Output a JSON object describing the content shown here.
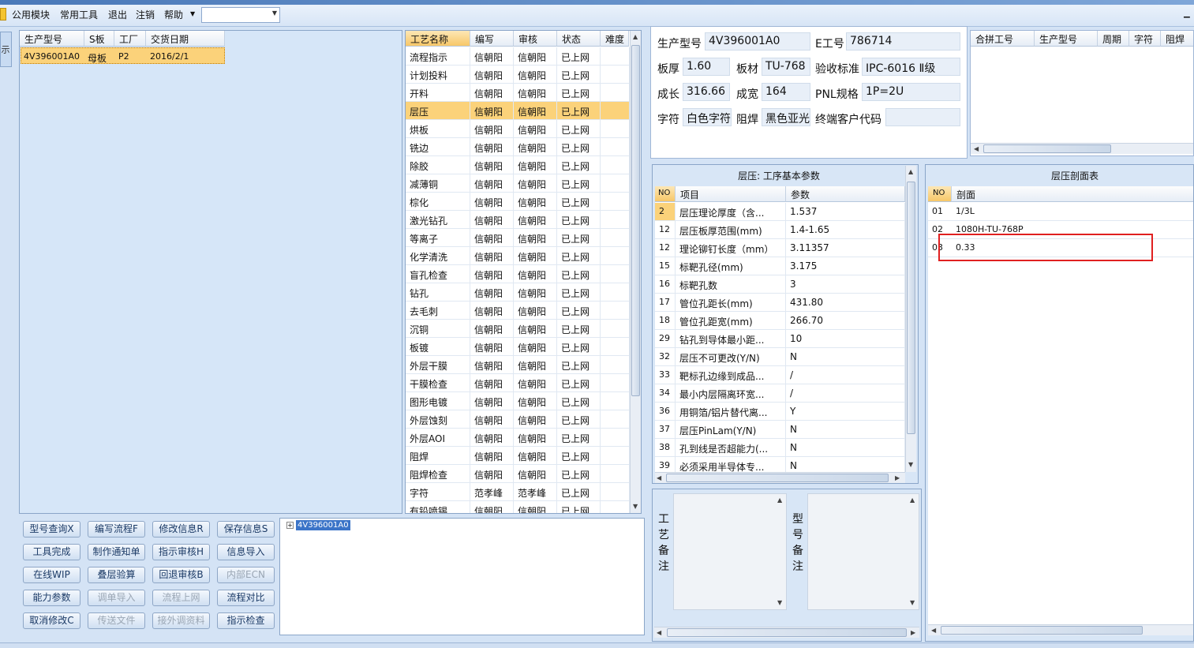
{
  "menu": {
    "items": [
      "公用模块",
      "常用工具",
      "退出",
      "注销",
      "帮助"
    ],
    "combo_value": ""
  },
  "left_tab": "示",
  "orders": {
    "headers": [
      "生产型号",
      "S板",
      "工厂",
      "交货日期"
    ],
    "rows": [
      [
        "4V396001A0",
        "母板",
        "P2",
        "2016/2/1"
      ]
    ]
  },
  "process": {
    "headers": [
      "工艺名称",
      "编写",
      "审核",
      "状态",
      "难度"
    ],
    "rows": [
      [
        "流程指示",
        "信朝阳",
        "信朝阳",
        "已上网",
        ""
      ],
      [
        "计划投料",
        "信朝阳",
        "信朝阳",
        "已上网",
        ""
      ],
      [
        "开料",
        "信朝阳",
        "信朝阳",
        "已上网",
        ""
      ],
      [
        "层压",
        "信朝阳",
        "信朝阳",
        "已上网",
        ""
      ],
      [
        "烘板",
        "信朝阳",
        "信朝阳",
        "已上网",
        ""
      ],
      [
        "铣边",
        "信朝阳",
        "信朝阳",
        "已上网",
        ""
      ],
      [
        "除胶",
        "信朝阳",
        "信朝阳",
        "已上网",
        ""
      ],
      [
        "减薄铜",
        "信朝阳",
        "信朝阳",
        "已上网",
        ""
      ],
      [
        "棕化",
        "信朝阳",
        "信朝阳",
        "已上网",
        ""
      ],
      [
        "激光钻孔",
        "信朝阳",
        "信朝阳",
        "已上网",
        ""
      ],
      [
        "等离子",
        "信朝阳",
        "信朝阳",
        "已上网",
        ""
      ],
      [
        "化学清洗",
        "信朝阳",
        "信朝阳",
        "已上网",
        ""
      ],
      [
        "盲孔检查",
        "信朝阳",
        "信朝阳",
        "已上网",
        ""
      ],
      [
        "钻孔",
        "信朝阳",
        "信朝阳",
        "已上网",
        ""
      ],
      [
        "去毛刺",
        "信朝阳",
        "信朝阳",
        "已上网",
        ""
      ],
      [
        "沉铜",
        "信朝阳",
        "信朝阳",
        "已上网",
        ""
      ],
      [
        "板镀",
        "信朝阳",
        "信朝阳",
        "已上网",
        ""
      ],
      [
        "外层干膜",
        "信朝阳",
        "信朝阳",
        "已上网",
        ""
      ],
      [
        "干膜检查",
        "信朝阳",
        "信朝阳",
        "已上网",
        ""
      ],
      [
        "图形电镀",
        "信朝阳",
        "信朝阳",
        "已上网",
        ""
      ],
      [
        "外层蚀刻",
        "信朝阳",
        "信朝阳",
        "已上网",
        ""
      ],
      [
        "外层AOI",
        "信朝阳",
        "信朝阳",
        "已上网",
        ""
      ],
      [
        "阻焊",
        "信朝阳",
        "信朝阳",
        "已上网",
        ""
      ],
      [
        "阻焊检查",
        "信朝阳",
        "信朝阳",
        "已上网",
        ""
      ],
      [
        "字符",
        "范孝峰",
        "范孝峰",
        "已上网",
        ""
      ],
      [
        "有铅喷锡",
        "信朝阳",
        "信朝阳",
        "已上网",
        ""
      ]
    ],
    "selected_index": 3
  },
  "buttons": [
    {
      "label": "型号查询X",
      "enabled": true
    },
    {
      "label": "编写流程F",
      "enabled": true
    },
    {
      "label": "修改信息R",
      "enabled": true
    },
    {
      "label": "保存信息S",
      "enabled": true
    },
    {
      "label": "工具完成",
      "enabled": true
    },
    {
      "label": "制作通知单",
      "enabled": true
    },
    {
      "label": "指示审核H",
      "enabled": true
    },
    {
      "label": "信息导入",
      "enabled": true
    },
    {
      "label": "在线WIP",
      "enabled": true
    },
    {
      "label": "叠层验算",
      "enabled": true
    },
    {
      "label": "回退审核B",
      "enabled": true
    },
    {
      "label": "内部ECN",
      "enabled": false
    },
    {
      "label": "能力参数",
      "enabled": true
    },
    {
      "label": "调单导入",
      "enabled": false
    },
    {
      "label": "流程上网",
      "enabled": false
    },
    {
      "label": "流程对比",
      "enabled": true
    },
    {
      "label": "取消修改C",
      "enabled": true
    },
    {
      "label": "传送文件",
      "enabled": false
    },
    {
      "label": "接外调资料",
      "enabled": false
    },
    {
      "label": "指示检查",
      "enabled": true
    }
  ],
  "tree": {
    "node": "4V396001A0"
  },
  "info": {
    "prod_model_label": "生产型号",
    "prod_model": "4V396001A0",
    "e_no_label": "E工号",
    "e_no": "786714",
    "thickness_label": "板厚",
    "thickness": "1.60",
    "material_label": "板材",
    "material": "TU-768",
    "standard_label": "验收标准",
    "standard": "IPC-6016 Ⅱ级",
    "length_label": "成长",
    "length": "316.66",
    "width_label": "成宽",
    "width": "164",
    "pnl_label": "PNL规格",
    "pnl": "1P=2U",
    "char_label": "字符",
    "char": "白色字符",
    "mask_label": "阻焊",
    "mask": "黑色亚光",
    "enduser_label": "终端客户代码",
    "enduser": ""
  },
  "merge_table": {
    "headers": [
      "合拼工号",
      "生产型号",
      "周期",
      "字符",
      "阻焊"
    ]
  },
  "params": {
    "title": "层压: 工序基本参数",
    "headers": [
      "NO",
      "项目",
      "参数"
    ],
    "rows": [
      [
        "2",
        "层压理论厚度（含...",
        "1.537"
      ],
      [
        "12",
        "层压板厚范围(mm)",
        "1.4-1.65"
      ],
      [
        "12",
        "理论铆钉长度（mm）",
        "3.11357"
      ],
      [
        "15",
        "标靶孔径(mm)",
        "3.175"
      ],
      [
        "16",
        "标靶孔数",
        "3"
      ],
      [
        "17",
        "管位孔距长(mm)",
        "431.80"
      ],
      [
        "18",
        "管位孔距宽(mm)",
        "266.70"
      ],
      [
        "29",
        "钻孔到导体最小距...",
        "10"
      ],
      [
        "32",
        "层压不可更改(Y/N)",
        "N"
      ],
      [
        "33",
        "靶标孔边缘到成品...",
        "/"
      ],
      [
        "34",
        "最小内层隔离环宽...",
        "/"
      ],
      [
        "36",
        "用铜箔/铝片替代离...",
        "Y"
      ],
      [
        "37",
        "层压PinLam(Y/N)",
        "N"
      ],
      [
        "38",
        "孔到线是否超能力(...",
        "N"
      ],
      [
        "39",
        "必须采用半导体专...",
        "N"
      ]
    ]
  },
  "section": {
    "title": "层压剖面表",
    "headers": [
      "NO",
      "剖面"
    ],
    "rows": [
      [
        "01",
        "1/3L"
      ],
      [
        "02",
        "1080H-TU-768P"
      ],
      [
        "03",
        "0.33"
      ]
    ]
  },
  "remarks": {
    "process_label": "工艺备注",
    "model_label": "型号备注"
  }
}
